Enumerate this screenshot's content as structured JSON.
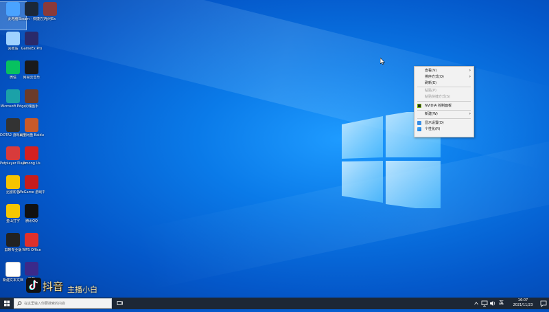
{
  "desktop_icons": [
    {
      "label": "此电脑",
      "icon": "computer-icon",
      "color": "#4aa3ff",
      "selected": true
    },
    {
      "label": "Steam · 快捷方式",
      "icon": "steam-icon",
      "color": "#1b2838"
    },
    {
      "label": "哈利Ex",
      "icon": "game-icon",
      "color": "#8a3a3a"
    },
    {
      "label": "回收站",
      "icon": "recycle-bin-icon",
      "color": "#9fd2ff"
    },
    {
      "label": "GameEx Pro",
      "icon": "se-icon",
      "color": "#2a2a6a"
    },
    {
      "label": "微信",
      "icon": "wechat-icon",
      "color": "#07c160"
    },
    {
      "label": "网易云音乐",
      "icon": "app-icon",
      "color": "#1a1a1a"
    },
    {
      "label": "Microsoft Edge",
      "icon": "edge-icon",
      "color": "#1ba1a8"
    },
    {
      "label": "灵魂画手",
      "icon": "character-icon",
      "color": "#6b3b2a"
    },
    {
      "label": "DOTA2 游戏助手",
      "icon": "dota-icon",
      "color": "#333333"
    },
    {
      "label": "百度网盘 Baidu",
      "icon": "paw-icon",
      "color": "#c85a2a"
    },
    {
      "label": "Potplayer Player",
      "icon": "potplayer-icon",
      "color": "#d83b3b"
    },
    {
      "label": "Among Us",
      "icon": "among-us-icon",
      "color": "#d32020"
    },
    {
      "label": "迅雷影音",
      "icon": "app-icon",
      "color": "#f5c400"
    },
    {
      "label": "WeGame 游戏平台",
      "icon": "app-icon",
      "color": "#c71c1c"
    },
    {
      "label": "金山打字",
      "icon": "app-icon",
      "color": "#f6c700"
    },
    {
      "label": "腾讯QQ",
      "icon": "qq-icon",
      "color": "#111111"
    },
    {
      "label": "剪映专业版",
      "icon": "app-icon",
      "color": "#222222"
    },
    {
      "label": "WPS Office",
      "icon": "wps-icon",
      "color": "#e0302b"
    },
    {
      "label": "新建文本文档",
      "icon": "document-icon",
      "color": "#ffffff"
    },
    {
      "label": "抖音",
      "icon": "app-icon",
      "color": "#3b2a8a"
    }
  ],
  "context_menu": {
    "items": [
      {
        "label": "查看(V)",
        "submenu": true
      },
      {
        "label": "排序方式(O)",
        "submenu": true
      },
      {
        "label": "刷新(E)"
      },
      {
        "separator": true
      },
      {
        "label": "粘贴(P)",
        "disabled": true
      },
      {
        "label": "粘贴快捷方式(S)",
        "disabled": true
      },
      {
        "separator": true
      },
      {
        "label": "NVIDIA 控制面板",
        "icon": "nvidia-icon"
      },
      {
        "separator": true
      },
      {
        "label": "新建(W)",
        "submenu": true
      },
      {
        "separator": true
      },
      {
        "label": "显示设置(D)",
        "icon": "display-icon"
      },
      {
        "label": "个性化(R)",
        "icon": "personalize-icon"
      }
    ]
  },
  "watermark": {
    "text": "抖音",
    "subtext": "主播小白"
  },
  "taskbar": {
    "search_placeholder": "在这里输入你要搜索的内容",
    "time": "16:07",
    "date": "2021/11/23"
  }
}
